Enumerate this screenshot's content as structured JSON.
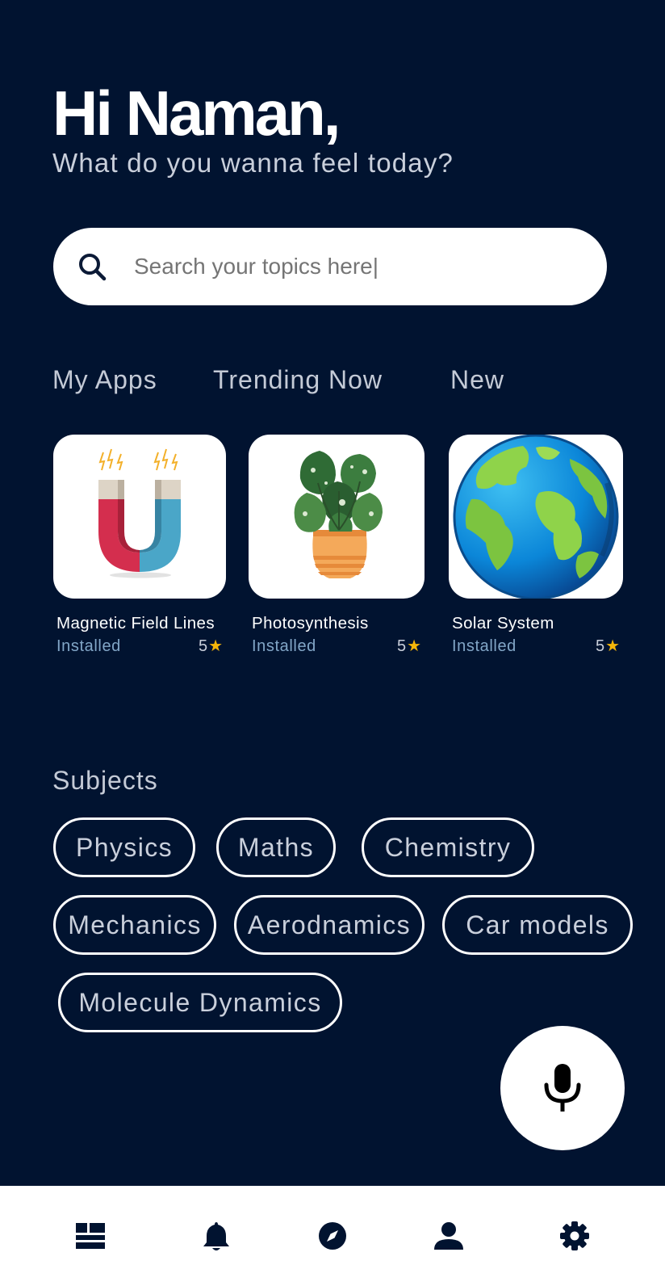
{
  "header": {
    "greeting": "Hi Naman,",
    "subtitle": "What do you wanna feel today?"
  },
  "search": {
    "placeholder": "Search your topics here|",
    "value": "",
    "icon": "search-icon"
  },
  "tabs": [
    {
      "label": "My Apps"
    },
    {
      "label": "Trending Now"
    },
    {
      "label": "New"
    }
  ],
  "apps": [
    {
      "name": "Magnetic Field Lines",
      "status": "Installed",
      "rating": "5",
      "icon": "magnet-icon"
    },
    {
      "name": "Photosynthesis",
      "status": "Installed",
      "rating": "5",
      "icon": "plant-icon"
    },
    {
      "name": "Solar System",
      "status": "Installed",
      "rating": "5",
      "icon": "earth-icon"
    }
  ],
  "subjects": {
    "title": "Subjects",
    "chips": [
      "Physics",
      "Maths",
      "Chemistry",
      "Mechanics",
      "Aerodnamics",
      "Car models",
      "Molecule Dynamics"
    ]
  },
  "fab": {
    "icon": "microphone-icon"
  },
  "bottom_nav": [
    {
      "icon": "dashboard-icon"
    },
    {
      "icon": "bell-icon"
    },
    {
      "icon": "compass-icon"
    },
    {
      "icon": "person-icon"
    },
    {
      "icon": "gear-icon"
    }
  ],
  "colors": {
    "background": "#011330",
    "surface": "#ffffff",
    "text_secondary": "#c9cfdb",
    "status": "#82a6c7",
    "star": "#f5b60a"
  }
}
